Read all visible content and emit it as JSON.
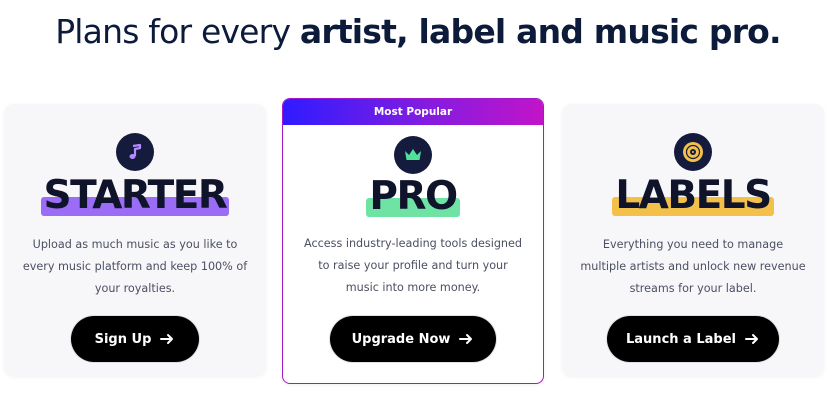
{
  "heading": {
    "light": "Plans for every ",
    "bold": "artist, label and music pro."
  },
  "plans": [
    {
      "id": "starter",
      "icon": "music-note-icon",
      "name": "STARTER",
      "highlight_color": "#9b6cf5",
      "description": "Upload as much music as you like to every music platform and keep 100% of your royalties.",
      "cta_label": "Sign Up"
    },
    {
      "id": "pro",
      "badge": "Most Popular",
      "icon": "crown-icon",
      "name": "PRO",
      "highlight_color": "#6fe3a4",
      "description": "Access industry-leading tools designed to raise your profile and turn your music into more money.",
      "cta_label": "Upgrade Now"
    },
    {
      "id": "labels",
      "icon": "vinyl-record-icon",
      "name": "LABELS",
      "highlight_color": "#f3c04a",
      "description": "Everything you need to manage multiple artists and unlock new revenue streams for your label.",
      "cta_label": "Launch a Label"
    }
  ],
  "colors": {
    "heading_text": "#0d1b3a",
    "icon_circle": "#141b3c",
    "pro_border": "#a318c7",
    "banner_gradient": [
      "#2f1bff",
      "#7b1de3",
      "#c214c9"
    ]
  }
}
